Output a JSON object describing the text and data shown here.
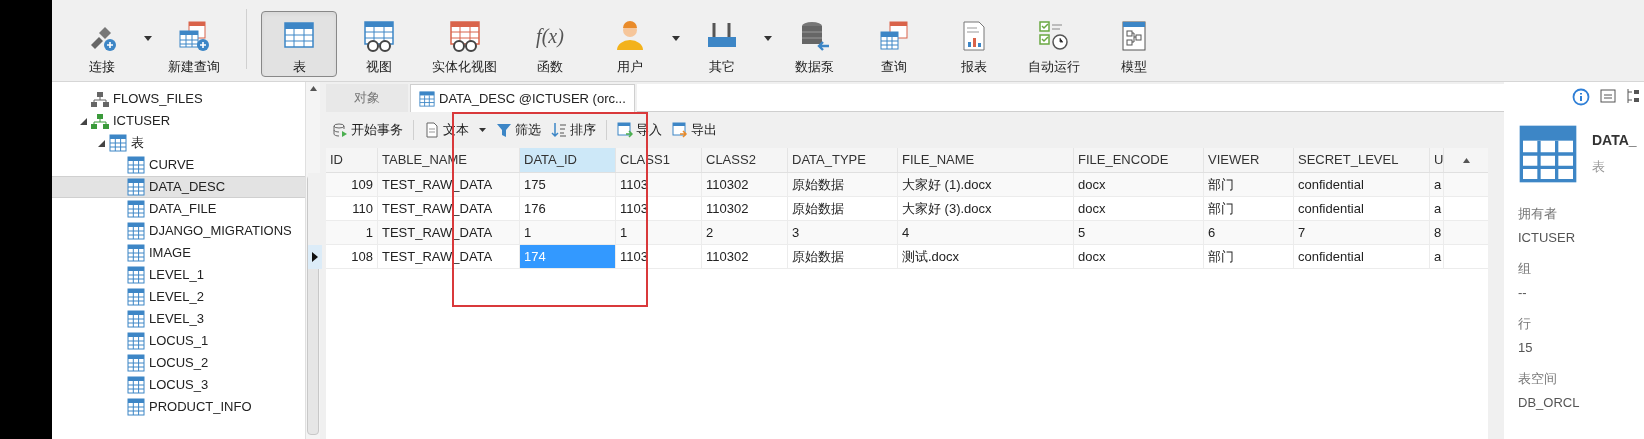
{
  "toolbar": [
    {
      "label": "连接",
      "dropdown": true,
      "selected": false
    },
    {
      "label": "新建查询",
      "dropdown": false,
      "selected": false
    },
    {
      "label": "表",
      "dropdown": false,
      "selected": true
    },
    {
      "label": "视图",
      "dropdown": false,
      "selected": false
    },
    {
      "label": "实体化视图",
      "dropdown": false,
      "selected": false
    },
    {
      "label": "函数",
      "glyph": "f(x)",
      "dropdown": false,
      "selected": false
    },
    {
      "label": "用户",
      "dropdown": true,
      "selected": false
    },
    {
      "label": "其它",
      "dropdown": true,
      "selected": false
    },
    {
      "label": "数据泵",
      "dropdown": false,
      "selected": false
    },
    {
      "label": "查询",
      "dropdown": false,
      "selected": false
    },
    {
      "label": "报表",
      "dropdown": false,
      "selected": false
    },
    {
      "label": "自动运行",
      "dropdown": false,
      "selected": false
    },
    {
      "label": "模型",
      "dropdown": false,
      "selected": false
    }
  ],
  "sidebar": {
    "items": [
      {
        "label": "FLOWS_FILES",
        "kind": "schema",
        "selected": false
      },
      {
        "label": "ICTUSER",
        "kind": "schema-active",
        "selected": false,
        "expanded": true,
        "children": [
          {
            "label": "表",
            "kind": "folder",
            "selected": false,
            "expanded": true,
            "children": [
              {
                "label": "CURVE",
                "kind": "table",
                "selected": false
              },
              {
                "label": "DATA_DESC",
                "kind": "table",
                "selected": true
              },
              {
                "label": "DATA_FILE",
                "kind": "table",
                "selected": false
              },
              {
                "label": "DJANGO_MIGRATIONS",
                "kind": "table",
                "selected": false
              },
              {
                "label": "IMAGE",
                "kind": "table",
                "selected": false
              },
              {
                "label": "LEVEL_1",
                "kind": "table",
                "selected": false
              },
              {
                "label": "LEVEL_2",
                "kind": "table",
                "selected": false
              },
              {
                "label": "LEVEL_3",
                "kind": "table",
                "selected": false
              },
              {
                "label": "LOCUS_1",
                "kind": "table",
                "selected": false
              },
              {
                "label": "LOCUS_2",
                "kind": "table",
                "selected": false
              },
              {
                "label": "LOCUS_3",
                "kind": "table",
                "selected": false
              },
              {
                "label": "PRODUCT_INFO",
                "kind": "table",
                "selected": false
              }
            ]
          }
        ]
      }
    ]
  },
  "tabs": [
    {
      "label": "对象",
      "selected": false
    },
    {
      "label": "DATA_DESC @ICTUSER (orc...",
      "selected": true
    }
  ],
  "actions": [
    {
      "label": "开始事务",
      "dropdown": false
    },
    {
      "label": "文本",
      "dropdown": true
    },
    {
      "label": "筛选",
      "dropdown": false
    },
    {
      "label": "排序",
      "dropdown": false
    },
    {
      "label": "导入",
      "dropdown": false
    },
    {
      "label": "导出",
      "dropdown": false
    }
  ],
  "table": {
    "columns": [
      {
        "label": "ID",
        "selected": false
      },
      {
        "label": "TABLE_NAME",
        "selected": false
      },
      {
        "label": "DATA_ID",
        "selected": true
      },
      {
        "label": "CLASS1",
        "selected": false
      },
      {
        "label": "CLASS2",
        "selected": false
      },
      {
        "label": "DATA_TYPE",
        "selected": false
      },
      {
        "label": "FILE_NAME",
        "selected": false
      },
      {
        "label": "FILE_ENCODE",
        "selected": false
      },
      {
        "label": "VIEWER",
        "selected": false
      },
      {
        "label": "SECRET_LEVEL",
        "selected": false
      },
      {
        "label": "U",
        "selected": false
      }
    ],
    "rows": [
      {
        "selected": false,
        "cells": [
          "109",
          "TEST_RAW_DATA",
          "175",
          "1103",
          "110302",
          "原始数据",
          "大家好 (1).docx",
          "docx",
          "部门",
          "confidential",
          "a"
        ]
      },
      {
        "selected": false,
        "cells": [
          "110",
          "TEST_RAW_DATA",
          "176",
          "1103",
          "110302",
          "原始数据",
          "大家好 (3).docx",
          "docx",
          "部门",
          "confidential",
          "a"
        ]
      },
      {
        "selected": false,
        "cells": [
          "1",
          "TEST_RAW_DATA",
          "1",
          "1",
          "2",
          "3",
          "4",
          "5",
          "6",
          "7",
          "8"
        ]
      },
      {
        "selected": true,
        "cells": [
          "108",
          "TEST_RAW_DATA",
          "174",
          "1103",
          "110302",
          "原始数据",
          "测试.docx",
          "docx",
          "部门",
          "confidential",
          "a"
        ]
      }
    ]
  },
  "info_panel": {
    "title": "DATA_",
    "subtitle": "表",
    "properties": [
      {
        "label": "拥有者",
        "value": "ICTUSER"
      },
      {
        "label": "组",
        "value": "--"
      },
      {
        "label": "行",
        "value": "15"
      },
      {
        "label": "表空间",
        "value": "DB_ORCL"
      }
    ]
  }
}
